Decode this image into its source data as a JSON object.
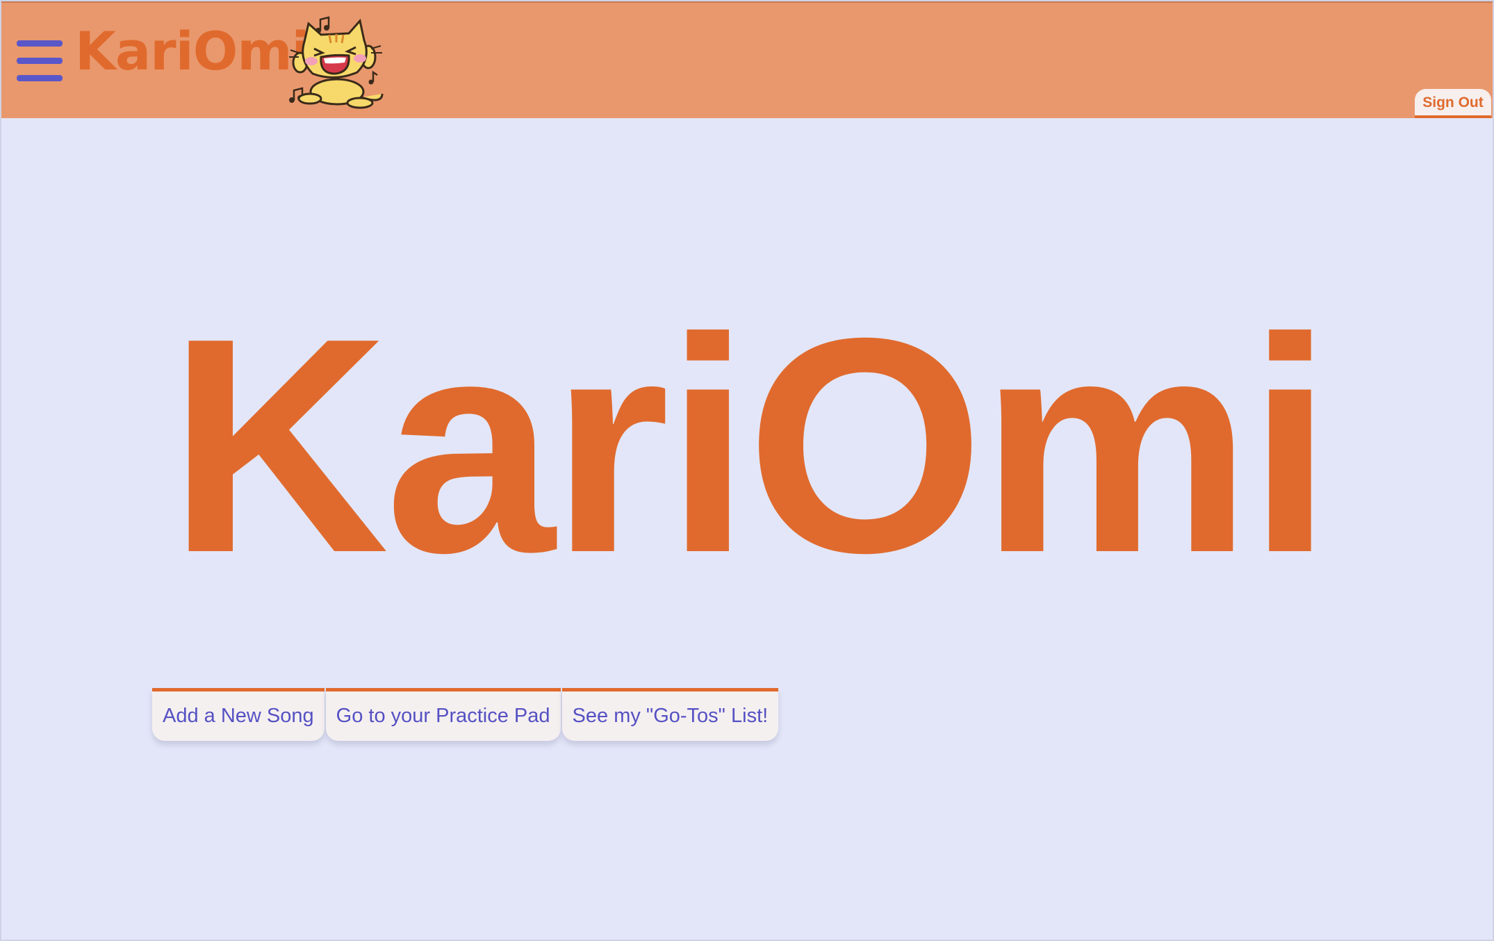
{
  "header": {
    "menu_icon": "hamburger-menu-icon",
    "logo_text": "KariOmi",
    "logo_mascot": "singing-cat-mascot",
    "sign_out_label": "Sign Out"
  },
  "hero": {
    "title": "KariOmi"
  },
  "actions": [
    {
      "label": "Add a New Song"
    },
    {
      "label": "Go to your Practice Pad"
    },
    {
      "label": "See my \"Go-Tos\" List!"
    }
  ],
  "colors": {
    "header_bg": "#e9986d",
    "page_bg": "#e3e6f8",
    "brand_orange": "#e06a2d",
    "menu_purple": "#5a57c9",
    "button_text": "#5551c3",
    "button_bg": "#f5f0f0"
  }
}
